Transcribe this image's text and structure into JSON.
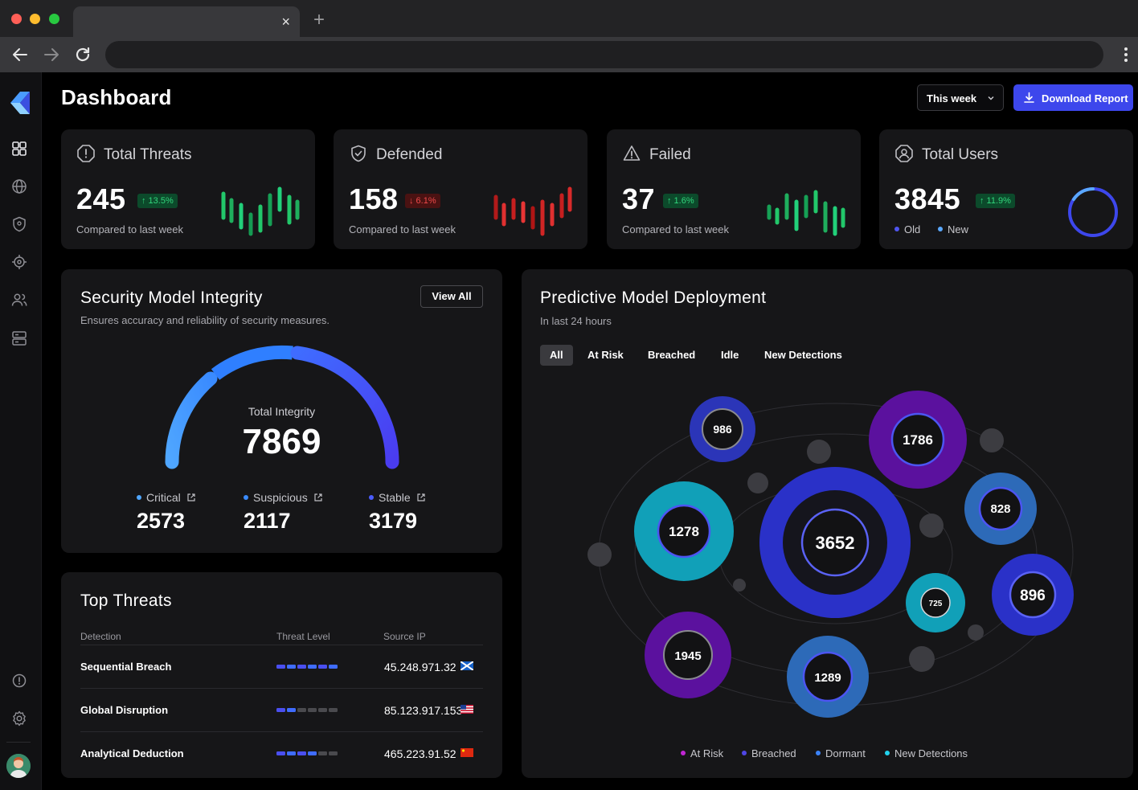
{
  "browser": {
    "tab_close": "×",
    "new_tab": "+"
  },
  "header": {
    "title": "Dashboard",
    "period": "This week",
    "download": "Download Report"
  },
  "stats": [
    {
      "title": "Total Threats",
      "value": "245",
      "delta": "↑ 13.5%",
      "sub": "Compared to last week"
    },
    {
      "title": "Defended",
      "value": "158",
      "delta": "↓ 6.1%",
      "sub": "Compared to last week"
    },
    {
      "title": "Failed",
      "value": "37",
      "delta": "↑ 1.6%",
      "sub": "Compared to last week"
    },
    {
      "title": "Total Users",
      "value": "3845",
      "delta": "↑ 11.9%",
      "legend_old": "Old",
      "legend_new": "New"
    }
  ],
  "integrity": {
    "title": "Security Model Integrity",
    "subtitle": "Ensures accuracy and reliability of security measures.",
    "view_all": "View All",
    "gauge_label": "Total Integrity",
    "gauge_value": "7869",
    "metrics": [
      {
        "label": "Critical",
        "value": "2573"
      },
      {
        "label": "Suspicious",
        "value": "2117"
      },
      {
        "label": "Stable",
        "value": "3179"
      }
    ]
  },
  "threats": {
    "title": "Top Threats",
    "columns": [
      "Detection",
      "Threat Level",
      "Source IP"
    ],
    "rows": [
      {
        "name": "Sequential Breach",
        "level": 6,
        "ip": "45.248.971.32",
        "flag": "scotland"
      },
      {
        "name": "Global Disruption",
        "level": 2,
        "ip": "85.123.917.153",
        "flag": "usa"
      },
      {
        "name": "Analytical Deduction",
        "level": 4,
        "ip": "465.223.91.52",
        "flag": "china"
      }
    ]
  },
  "deployment": {
    "title": "Predictive Model Deployment",
    "subtitle": "In last 24 hours",
    "tabs": [
      "All",
      "At Risk",
      "Breached",
      "Idle",
      "New Detections"
    ],
    "nodes": [
      "986",
      "1786",
      "1278",
      "3652",
      "828",
      "725",
      "896",
      "1945",
      "1289"
    ],
    "legend": [
      "At Risk",
      "Breached",
      "Dormant",
      "New Detections"
    ]
  },
  "colors": {
    "accent": "#3d47ec",
    "up": "#32d67c",
    "down": "#f04a4a",
    "at_risk": "#c026d3",
    "breached": "#4f46e5",
    "dormant": "#3b82f6",
    "new_detections": "#22d3ee"
  }
}
